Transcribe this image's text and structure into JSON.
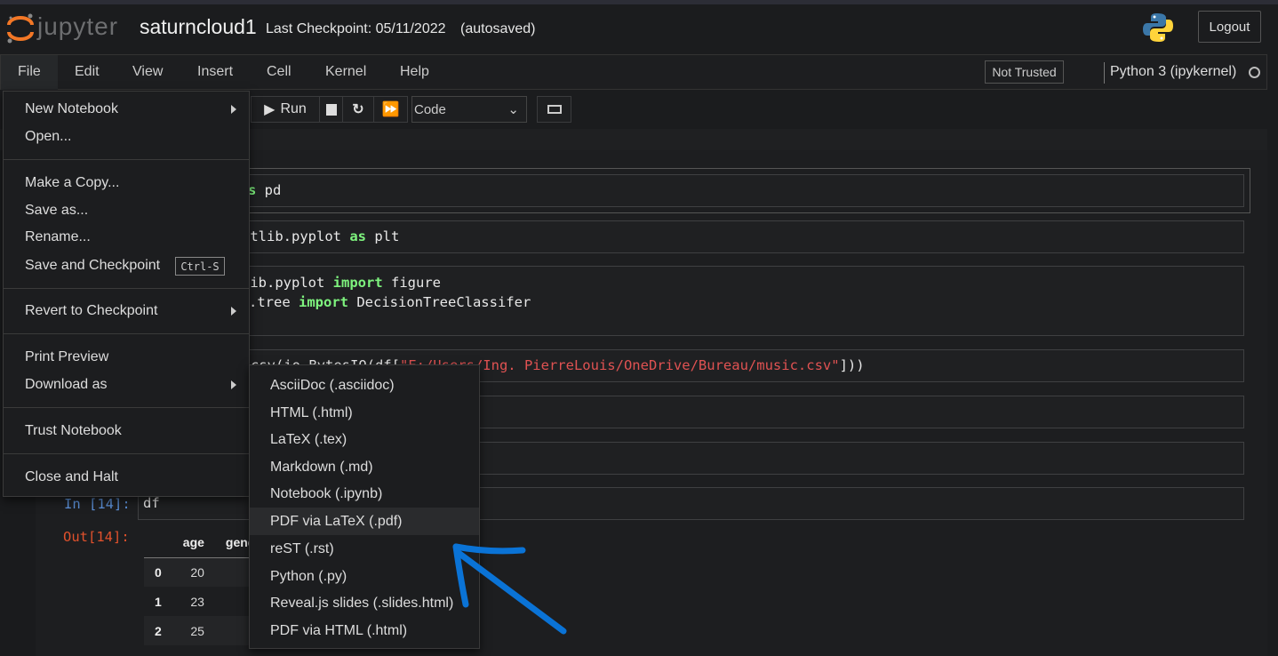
{
  "header": {
    "logo": "jupyter",
    "notebook_name": "saturncloud1",
    "checkpoint": "Last Checkpoint: 05/11/2022",
    "autosaved": "(autosaved)",
    "logout": "Logout"
  },
  "menubar": {
    "items": [
      "File",
      "Edit",
      "View",
      "Insert",
      "Cell",
      "Kernel",
      "Help"
    ],
    "trust_status": "Not Trusted",
    "kernel": "Python 3 (ipykernel)"
  },
  "toolbar": {
    "run": "Run",
    "cell_type": "Code"
  },
  "cells": {
    "c1": {
      "pre": "s ",
      "kw": "as",
      "post": " pd"
    },
    "c2": {
      "pre": "otlib.pyplot ",
      "kw": "as",
      "post": " plt"
    },
    "c3": {
      "l1pre": "lib.pyplot ",
      "l1kw": "import",
      "l1post": " figure",
      "l2pre": ".tree ",
      "l2kw": "import",
      "l2post": " DecisionTreeClassifer"
    },
    "c4": {
      "pre": "csv(io.BytesIO(df[",
      "str": "\"E:/Users/Ing. PierreLouis/OneDrive/Bureau/music.csv\"",
      "post": "]))"
    },
    "c7": {
      "prompt": "In [14]:",
      "code": "df"
    }
  },
  "output": {
    "prompt": "Out[14]:",
    "columns": [
      "",
      "age",
      "gend"
    ],
    "rows": [
      [
        "0",
        "20"
      ],
      [
        "1",
        "23"
      ],
      [
        "2",
        "25"
      ]
    ]
  },
  "file_menu": {
    "items": [
      "New Notebook",
      "Open...",
      "Make a Copy...",
      "Save as...",
      "Rename...",
      "Save and Checkpoint",
      "Revert to Checkpoint",
      "Print Preview",
      "Download as",
      "Trust Notebook",
      "Close and Halt"
    ],
    "shortcut": "Ctrl-S"
  },
  "download_menu": {
    "items": [
      "AsciiDoc (.asciidoc)",
      "HTML (.html)",
      "LaTeX (.tex)",
      "Markdown (.md)",
      "Notebook (.ipynb)",
      "PDF via LaTeX (.pdf)",
      "reST (.rst)",
      "Python (.py)",
      "Reveal.js slides (.slides.html)",
      "PDF via HTML (.html)"
    ],
    "highlighted": "PDF via LaTeX (.pdf)"
  },
  "colors": {
    "accent_orange": "#f37726",
    "keyword": "#7ef37e",
    "string": "#e05252",
    "in_prompt": "#5b8fd6",
    "out_prompt": "#e0512c",
    "annotation_arrow": "#0a73d6"
  }
}
